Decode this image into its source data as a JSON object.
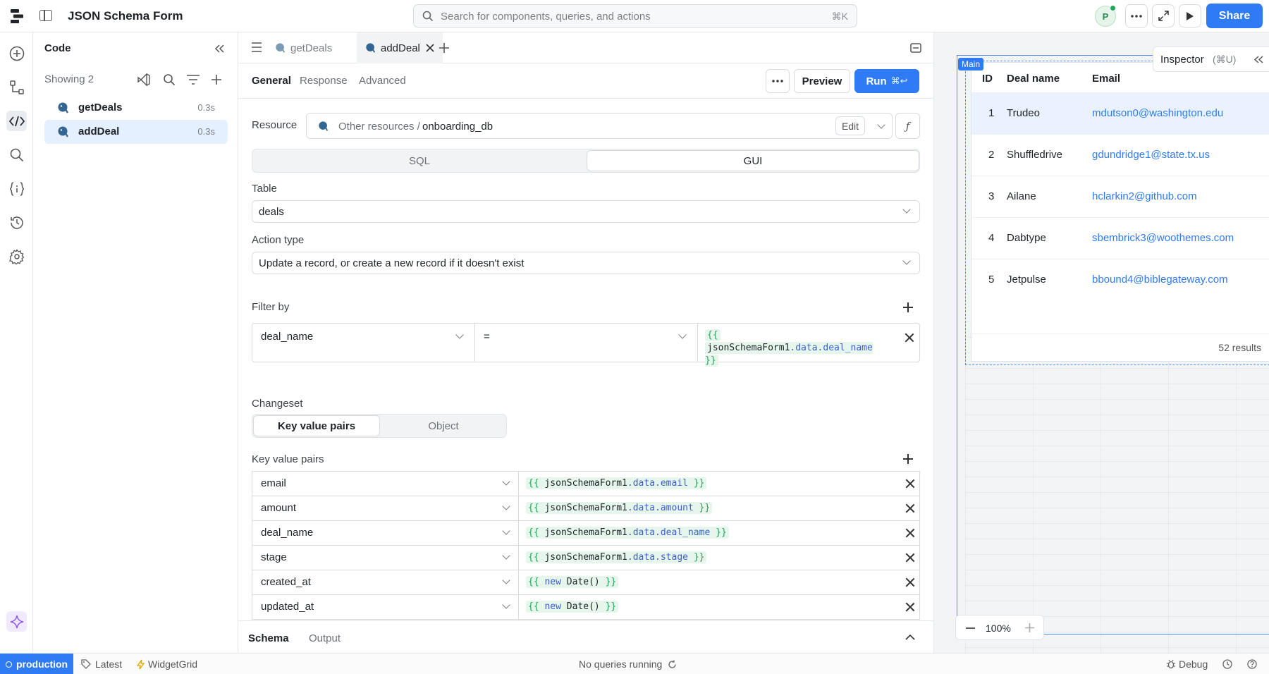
{
  "app": {
    "title": "JSON Schema Form"
  },
  "search": {
    "placeholder": "Search for components, queries, and actions",
    "shortcut": "⌘K"
  },
  "header": {
    "avatar_initial": "P",
    "share_label": "Share"
  },
  "code_panel": {
    "title": "Code",
    "showing": "Showing 2",
    "queries": [
      {
        "name": "getDeals",
        "time": "0.3s"
      },
      {
        "name": "addDeal",
        "time": "0.3s"
      }
    ]
  },
  "editor": {
    "tabs": [
      "getDeals",
      "addDeal"
    ],
    "subtabs": [
      "General",
      "Response",
      "Advanced"
    ],
    "preview_label": "Preview",
    "run_label": "Run",
    "run_shortcut": "⌘↩",
    "resource": {
      "label": "Resource",
      "prefix": "Other resources /",
      "name": "onboarding_db",
      "edit_label": "Edit"
    },
    "mode_toggle": [
      "SQL",
      "GUI"
    ],
    "table": {
      "label": "Table",
      "value": "deals"
    },
    "action_type": {
      "label": "Action type",
      "value": "Update a record, or create a new record if it doesn't exist"
    },
    "filter": {
      "label": "Filter by",
      "column": "deal_name",
      "operator": "=",
      "value_open": "{{",
      "value_ref": "jsonSchemaForm1",
      "value_prop": ".data.deal_name",
      "value_close": "}}"
    },
    "changeset": {
      "label": "Changeset",
      "options": [
        "Key value pairs",
        "Object"
      ]
    },
    "kv": {
      "label": "Key value pairs",
      "rows": [
        {
          "key": "email",
          "ref": "jsonSchemaForm1",
          "prop": ".data.email"
        },
        {
          "key": "amount",
          "ref": "jsonSchemaForm1",
          "prop": ".data.amount"
        },
        {
          "key": "deal_name",
          "ref": "jsonSchemaForm1",
          "prop": ".data.deal_name"
        },
        {
          "key": "stage",
          "ref": "jsonSchemaForm1",
          "prop": ".data.stage"
        },
        {
          "key": "created_at",
          "kw": "new",
          "fn": "Date()"
        },
        {
          "key": "updated_at",
          "kw": "new",
          "fn": "Date()"
        }
      ],
      "open": "{{",
      "close": "}}"
    },
    "bottom_tabs": [
      "Schema",
      "Output"
    ]
  },
  "canvas": {
    "main_badge": "Main",
    "inspector_label": "Inspector",
    "inspector_shortcut": "(⌘U)",
    "table": {
      "headers": [
        "ID",
        "Deal name",
        "Email"
      ],
      "rows": [
        {
          "id": "1",
          "name": "Trudeo",
          "email": "mdutson0@washington.edu"
        },
        {
          "id": "2",
          "name": "Shuffledrive",
          "email": "gdundridge1@state.tx.us"
        },
        {
          "id": "3",
          "name": "Ailane",
          "email": "hclarkin2@github.com"
        },
        {
          "id": "4",
          "name": "Dabtype",
          "email": "sbembrick3@woothemes.com"
        },
        {
          "id": "5",
          "name": "Jetpulse",
          "email": "bbound4@biblegateway.com"
        }
      ],
      "results": "52 results"
    },
    "zoom": "100%"
  },
  "status": {
    "environment": "production",
    "version": "Latest",
    "widget": "WidgetGrid",
    "queries": "No queries running",
    "debug": "Debug"
  },
  "colors": {
    "accent": "#2f7bf5",
    "highlight": "#e4efff",
    "token_bg": "#e6f6ec"
  }
}
